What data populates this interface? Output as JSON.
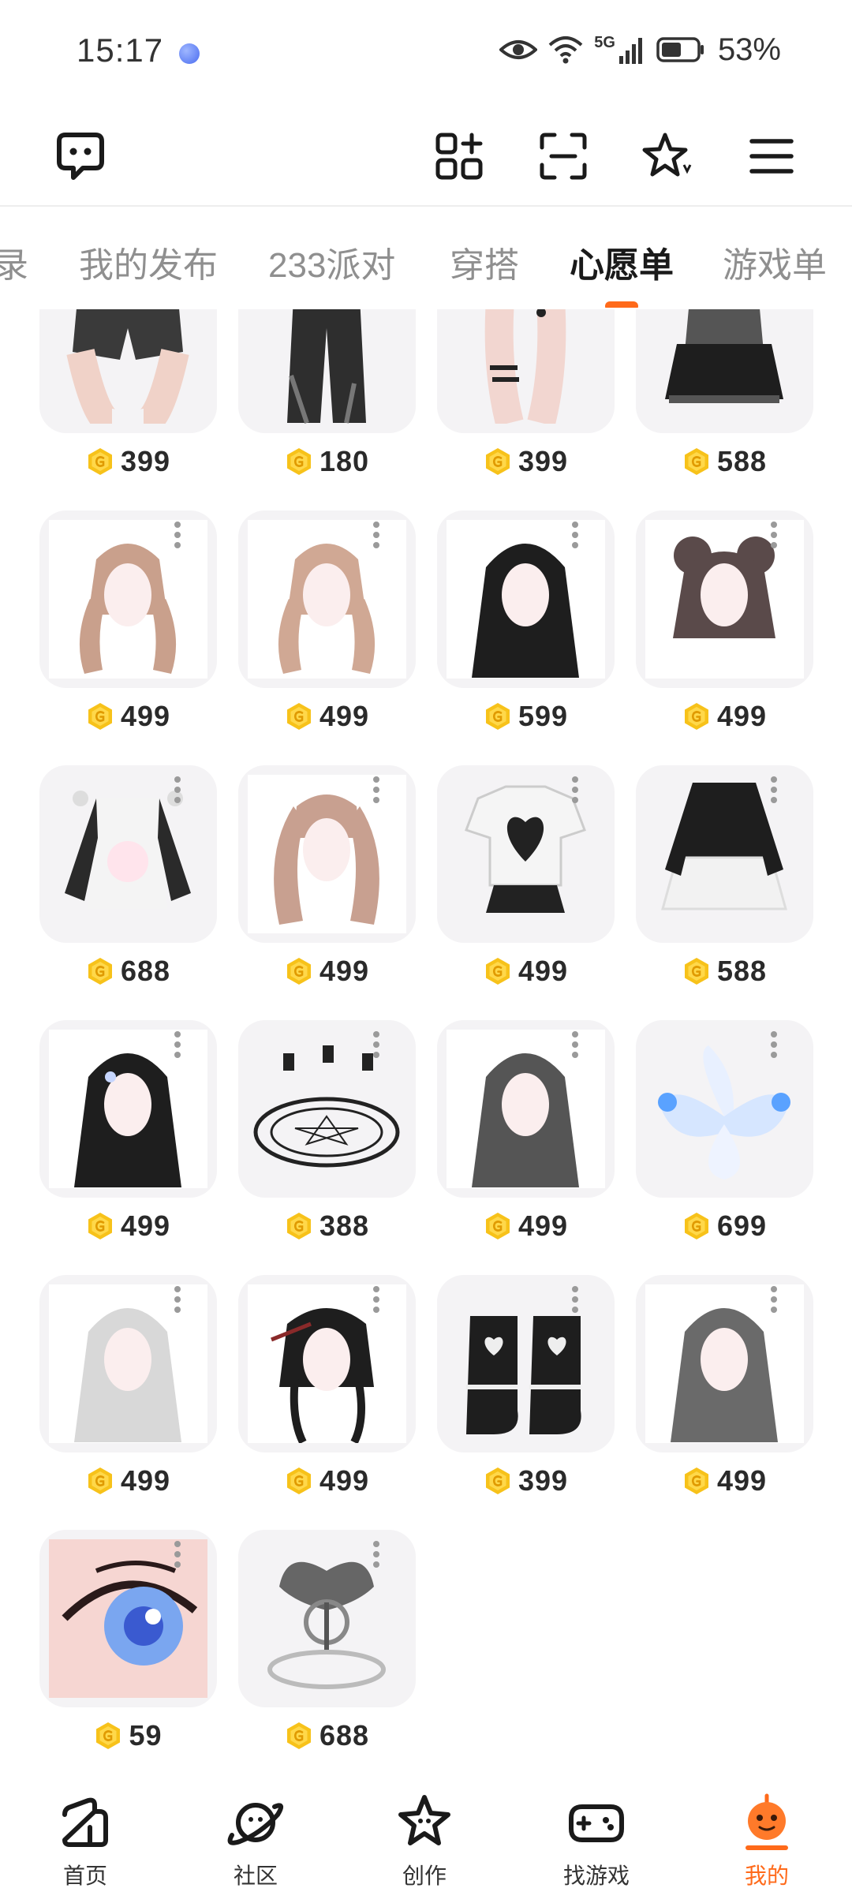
{
  "status_bar": {
    "time": "15:17",
    "network": "5G",
    "battery": "53%"
  },
  "toolbar": {
    "left_icon": "chat-bubble-icon",
    "right_icons": [
      "grid-plus-icon",
      "scan-icon",
      "star-sparkle-icon",
      "menu-icon"
    ]
  },
  "tabs": [
    {
      "label": "录"
    },
    {
      "label": "我的发布"
    },
    {
      "label": "233派对"
    },
    {
      "label": "穿搭"
    },
    {
      "label": "心愿单",
      "active": true
    },
    {
      "label": "游戏单"
    }
  ],
  "wishlist": {
    "items": [
      {
        "kind": "shorts",
        "price": "399"
      },
      {
        "kind": "pants",
        "price": "180"
      },
      {
        "kind": "tights",
        "price": "399"
      },
      {
        "kind": "top-skirt",
        "price": "588"
      },
      {
        "kind": "hair-pigtails-pink",
        "price": "499"
      },
      {
        "kind": "hair-braids-pink",
        "price": "499"
      },
      {
        "kind": "hair-long-black",
        "price": "599"
      },
      {
        "kind": "hair-buns",
        "price": "499"
      },
      {
        "kind": "jacket-bunny",
        "price": "688"
      },
      {
        "kind": "hair-twintails",
        "price": "499"
      },
      {
        "kind": "tshirt-skirt",
        "price": "499"
      },
      {
        "kind": "dress-black",
        "price": "588"
      },
      {
        "kind": "hair-black-clip",
        "price": "499"
      },
      {
        "kind": "magic-circle",
        "price": "388"
      },
      {
        "kind": "hair-wavy-grey",
        "price": "499"
      },
      {
        "kind": "fox-tails",
        "price": "699"
      },
      {
        "kind": "hair-silver",
        "price": "499"
      },
      {
        "kind": "hair-black-bun",
        "price": "499"
      },
      {
        "kind": "boots",
        "price": "399"
      },
      {
        "kind": "hair-grey-ombre",
        "price": "499"
      },
      {
        "kind": "eye",
        "price": "59"
      },
      {
        "kind": "wings-emblem",
        "price": "688"
      }
    ]
  },
  "bottom_nav": [
    {
      "label": "首页",
      "icon": "home-icon"
    },
    {
      "label": "社区",
      "icon": "planet-icon"
    },
    {
      "label": "创作",
      "icon": "star-face-icon"
    },
    {
      "label": "找游戏",
      "icon": "gamepad-icon"
    },
    {
      "label": "我的",
      "icon": "avatar-icon",
      "active": true
    }
  ],
  "colors": {
    "accent": "#ff6a1a",
    "coin": "#f7c21a",
    "card_bg": "#f4f3f5"
  }
}
